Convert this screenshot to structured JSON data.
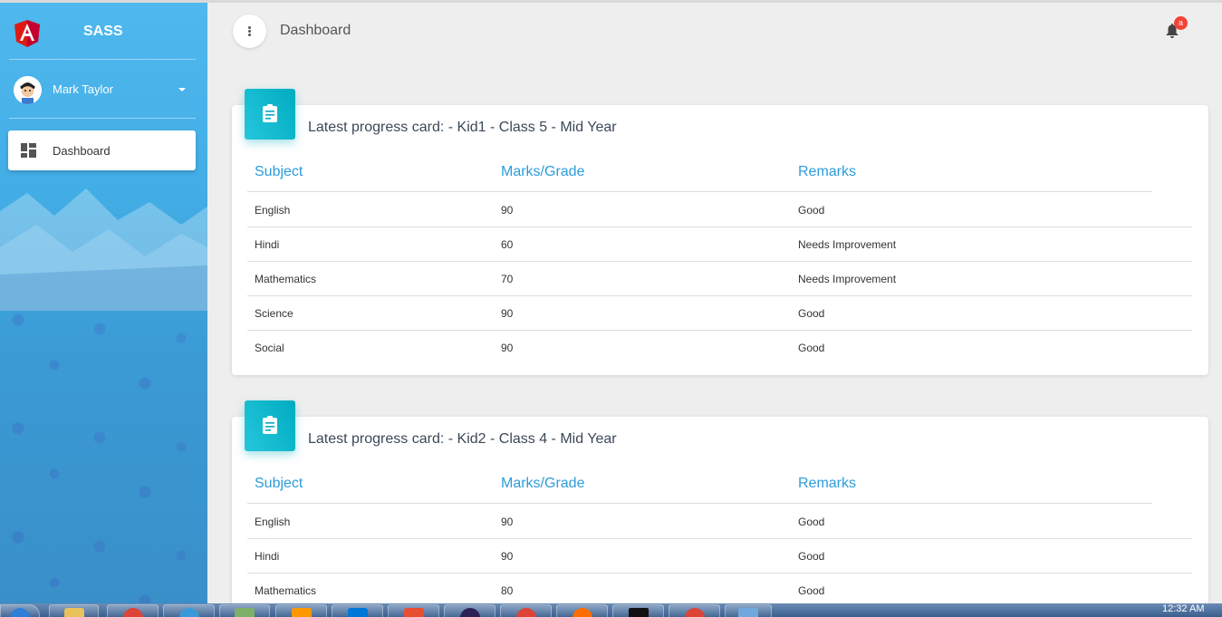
{
  "app": {
    "brand_name": "SASS",
    "user_name": "Mark Taylor"
  },
  "sidebar": {
    "items": [
      {
        "label": "Dashboard",
        "icon": "dashboard-icon",
        "active": true
      }
    ]
  },
  "header": {
    "title": "Dashboard",
    "notification_count": "a"
  },
  "cards": [
    {
      "title": "Latest progress card: - Kid1 - Class 5 - Mid Year",
      "columns": [
        "Subject",
        "Marks/Grade",
        "Remarks"
      ],
      "rows": [
        [
          "English",
          "90",
          "Good"
        ],
        [
          "Hindi",
          "60",
          "Needs Improvement"
        ],
        [
          "Mathematics",
          "70",
          "Needs Improvement"
        ],
        [
          "Science",
          "90",
          "Good"
        ],
        [
          "Social",
          "90",
          "Good"
        ]
      ]
    },
    {
      "title": "Latest progress card: - Kid2 - Class 4 - Mid Year",
      "columns": [
        "Subject",
        "Marks/Grade",
        "Remarks"
      ],
      "rows": [
        [
          "English",
          "90",
          "Good"
        ],
        [
          "Hindi",
          "90",
          "Good"
        ],
        [
          "Mathematics",
          "80",
          "Good"
        ]
      ]
    }
  ],
  "taskbar": {
    "clock": "12:32 AM"
  },
  "colors": {
    "sidebar": "#43aee6",
    "accent": "#2d9cdb",
    "card_icon": "#00acc1",
    "badge": "#f44336"
  }
}
